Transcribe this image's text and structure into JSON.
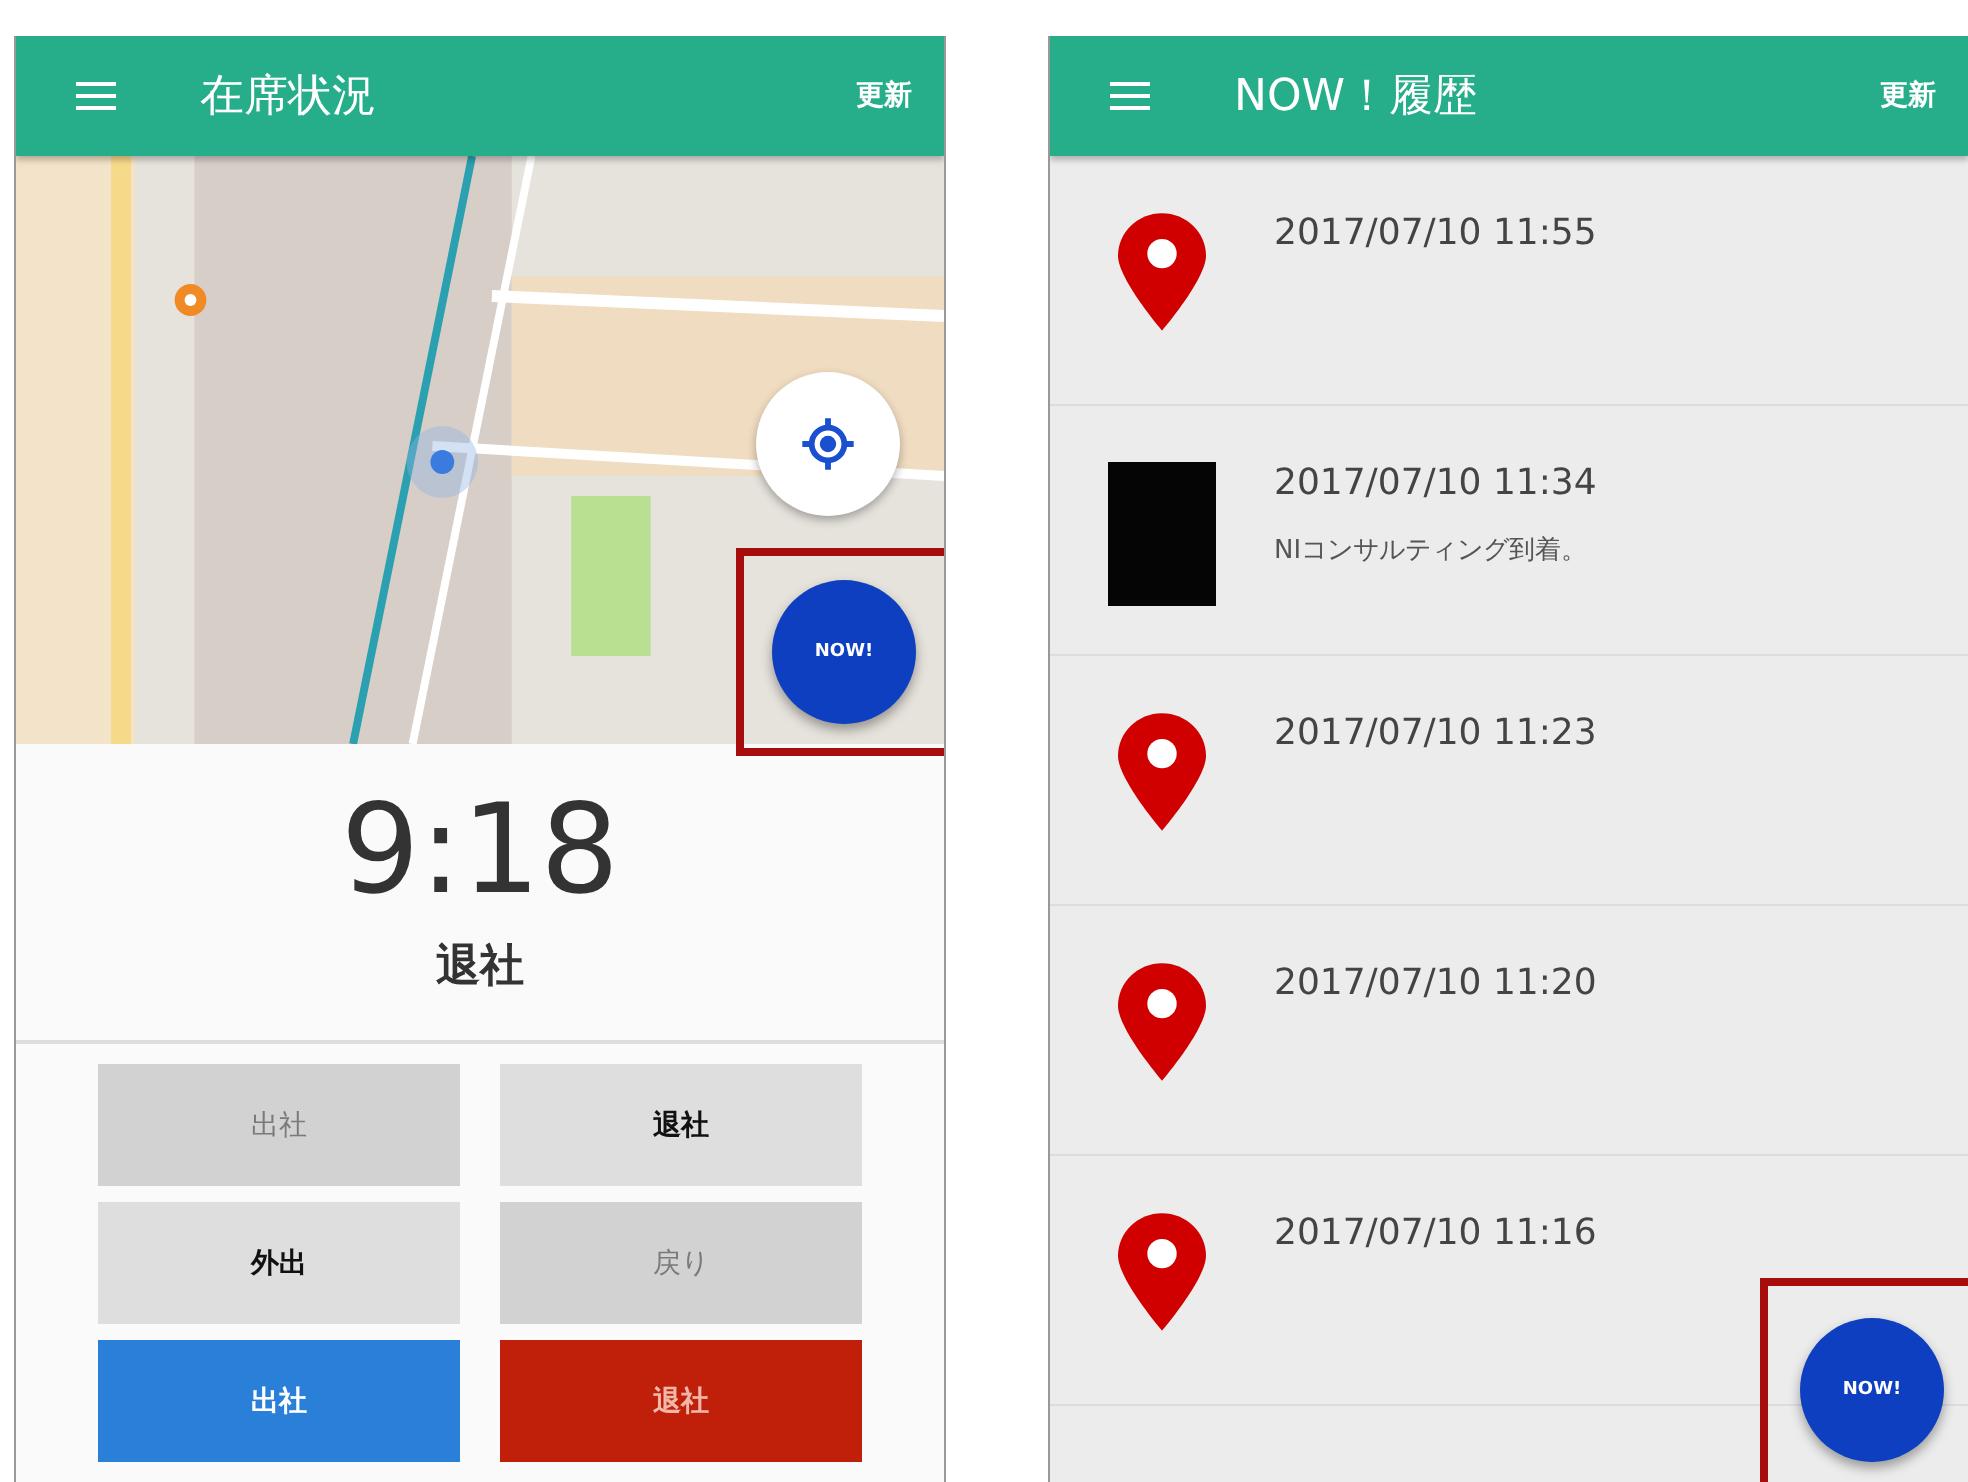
{
  "status_screen": {
    "app_bar": {
      "title": "在席状況",
      "action": "更新"
    },
    "location_button": {
      "highlighted": false
    },
    "now_button": {
      "label": "NOW!",
      "highlighted": true
    },
    "clock": "9:18",
    "status": "退社",
    "buttons": [
      {
        "label": "出社",
        "kind": "disabled"
      },
      {
        "label": "退社",
        "kind": "plain"
      },
      {
        "label": "外出",
        "kind": "plain"
      },
      {
        "label": "戻り",
        "kind": "disabled"
      },
      {
        "label": "出社",
        "kind": "primary"
      },
      {
        "label": "退社",
        "kind": "danger"
      }
    ]
  },
  "history_screen": {
    "app_bar": {
      "title": "NOW！履歴",
      "action": "更新"
    },
    "now_button": {
      "label": "NOW!",
      "highlighted": true
    },
    "entries": [
      {
        "kind": "pin",
        "time": "2017/07/10 11:55"
      },
      {
        "kind": "photo",
        "time": "2017/07/10 11:34",
        "note": "NIコンサルティング到着。"
      },
      {
        "kind": "pin",
        "time": "2017/07/10 11:23"
      },
      {
        "kind": "pin",
        "time": "2017/07/10 11:20"
      },
      {
        "kind": "pin",
        "time": "2017/07/10 11:16"
      }
    ]
  }
}
